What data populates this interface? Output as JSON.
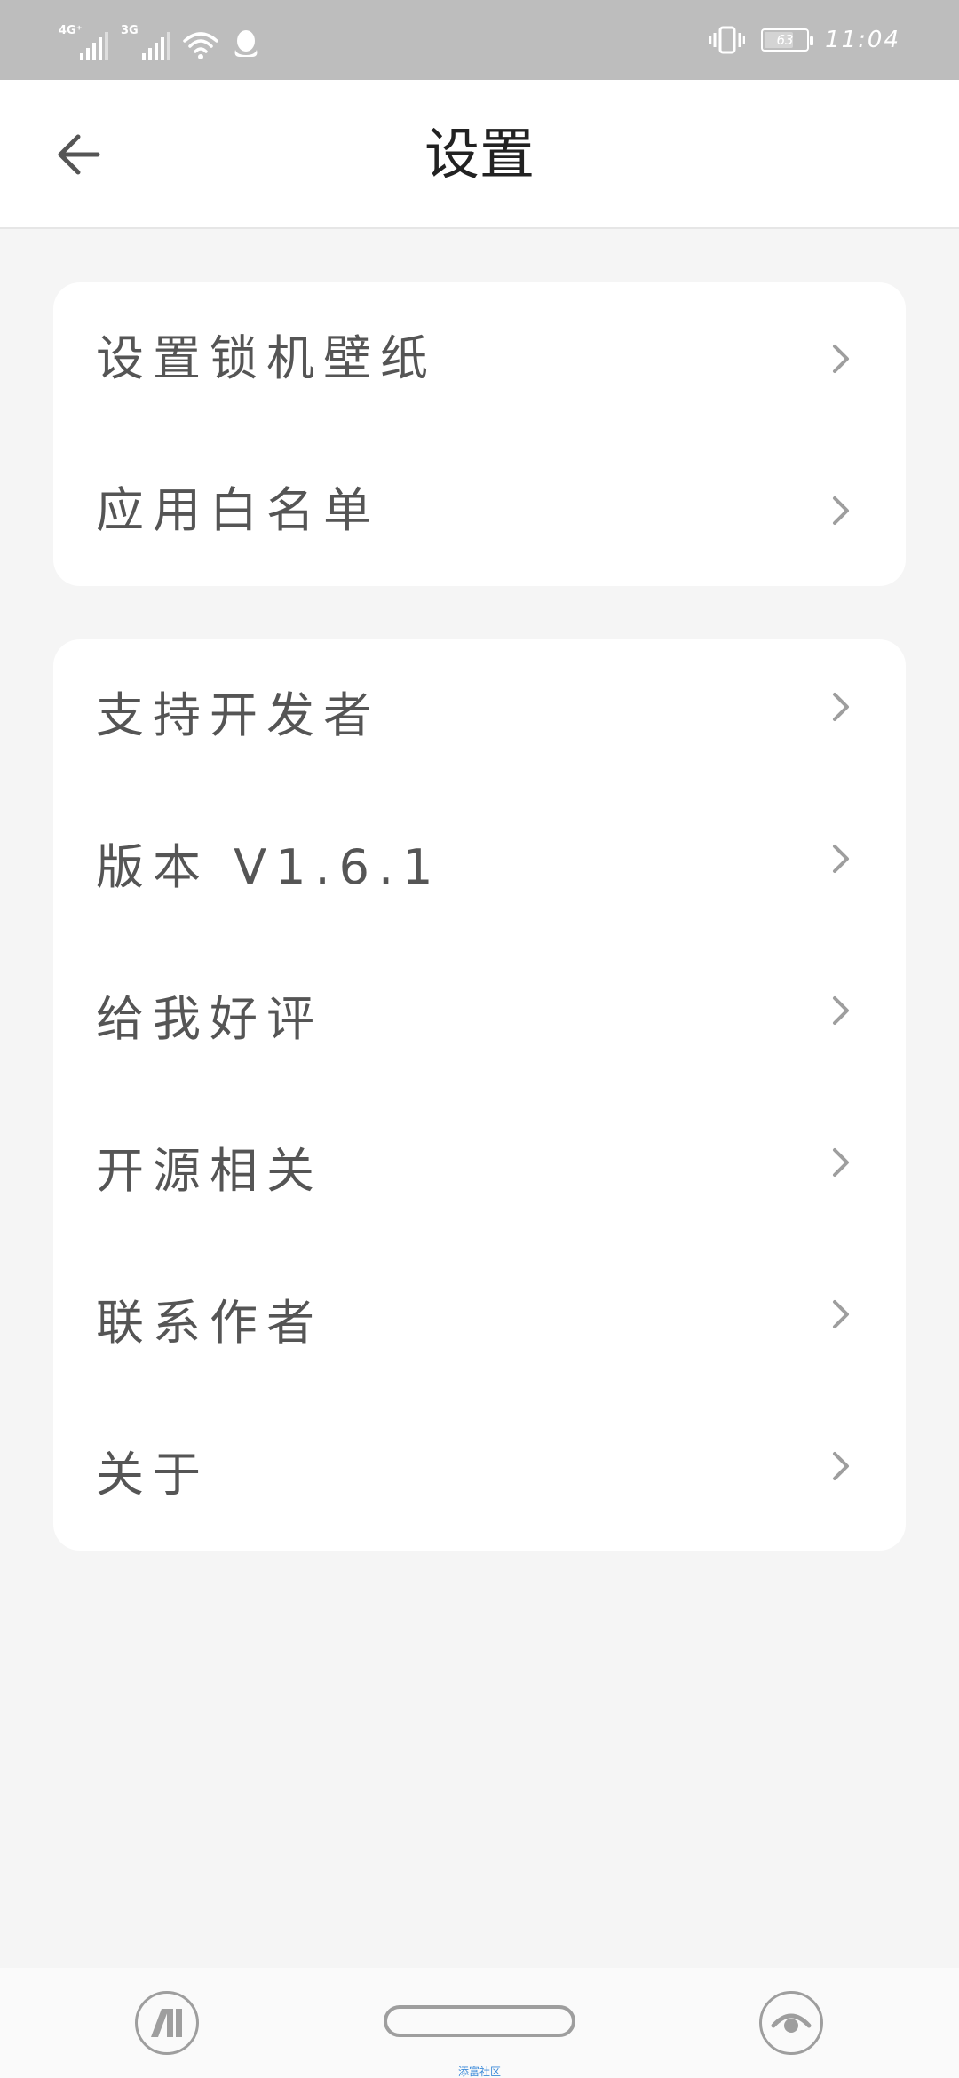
{
  "status_bar": {
    "network_1": "4G⁺",
    "network_2": "3G",
    "battery_level": "63",
    "time": "11:04",
    "icons": [
      "signal-icon",
      "wifi-icon",
      "qq-icon",
      "vibrate-icon",
      "battery-icon"
    ]
  },
  "header": {
    "title": "设置",
    "back_icon": "arrow-left-icon"
  },
  "groups": [
    {
      "items": [
        {
          "label": "设置锁机壁纸"
        },
        {
          "label": "应用白名单"
        }
      ]
    },
    {
      "items": [
        {
          "label": "支持开发者"
        },
        {
          "label": "版本 V1.6.1"
        },
        {
          "label": "给我好评"
        },
        {
          "label": "开源相关"
        },
        {
          "label": "联系作者"
        },
        {
          "label": "关于"
        }
      ]
    }
  ],
  "nav_bar": {
    "watermark": "添富社区"
  },
  "colors": {
    "status_bar": "#bdbdbd",
    "background": "#f5f5f5",
    "card": "#ffffff",
    "text": "#555555",
    "title": "#222222",
    "chevron": "#9e9e9e"
  }
}
